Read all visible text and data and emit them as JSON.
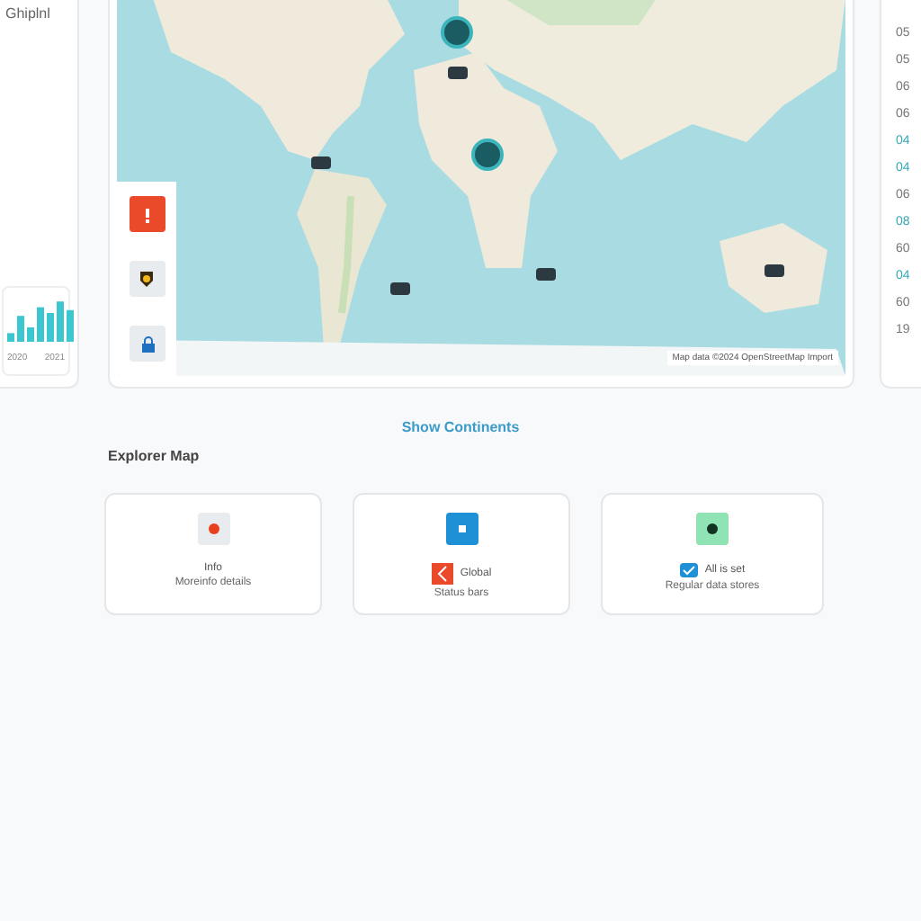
{
  "side_panel": {
    "title": "Ghiplnl",
    "chart_labels": [
      "2020",
      "2021"
    ]
  },
  "map": {
    "legend": [
      {
        "kind": "alert",
        "color": "#ea4a2a"
      },
      {
        "kind": "badge",
        "color": "#e9ecef"
      },
      {
        "kind": "pin",
        "color": "#e9ecef"
      }
    ],
    "markers": [
      {
        "kind": "cluster"
      },
      {
        "kind": "cluster"
      },
      {
        "kind": "tag"
      },
      {
        "kind": "tag"
      },
      {
        "kind": "tag"
      },
      {
        "kind": "tag"
      },
      {
        "kind": "tag"
      }
    ],
    "attribution": "Map data ©2024 OpenStreetMap Import"
  },
  "stats": [
    {
      "value": "05",
      "highlight": false
    },
    {
      "value": "05",
      "highlight": false
    },
    {
      "value": "06",
      "highlight": false
    },
    {
      "value": "06",
      "highlight": false
    },
    {
      "value": "04",
      "highlight": true
    },
    {
      "value": "04",
      "highlight": true
    },
    {
      "value": "06",
      "highlight": false
    },
    {
      "value": "08",
      "highlight": true
    },
    {
      "value": "60",
      "highlight": false
    },
    {
      "value": "04",
      "highlight": true
    },
    {
      "value": "60",
      "highlight": false
    },
    {
      "value": "19",
      "highlight": false
    }
  ],
  "heading": "Show Continents",
  "section_title": "Explorer Map",
  "cards": [
    {
      "kind": "plain",
      "color": "#e9ecef",
      "title": "Info",
      "subtitle": "Moreinfo details"
    },
    {
      "kind": "flagged",
      "color": "#1e90d6",
      "title": "Global",
      "subtitle": "Status bars"
    },
    {
      "kind": "checked",
      "color": "#8fe3b4",
      "title": "All is set",
      "subtitle": "Regular data stores"
    }
  ]
}
